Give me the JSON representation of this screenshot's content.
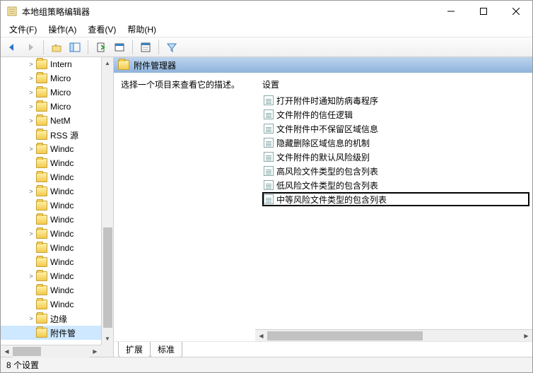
{
  "window": {
    "title": "本地组策略编辑器"
  },
  "menubar": {
    "file": "文件(F)",
    "action": "操作(A)",
    "view": "查看(V)",
    "help": "帮助(H)"
  },
  "tree": {
    "items": [
      {
        "label": "Intern",
        "expander": ">"
      },
      {
        "label": "Micro",
        "expander": ">"
      },
      {
        "label": "Micro",
        "expander": ">"
      },
      {
        "label": "Micro",
        "expander": ">"
      },
      {
        "label": "NetM",
        "expander": ">"
      },
      {
        "label": "RSS 源",
        "expander": ""
      },
      {
        "label": "Windc",
        "expander": ">"
      },
      {
        "label": "Windc",
        "expander": ""
      },
      {
        "label": "Windc",
        "expander": ""
      },
      {
        "label": "Windc",
        "expander": ">"
      },
      {
        "label": "Windc",
        "expander": ""
      },
      {
        "label": "Windc",
        "expander": ""
      },
      {
        "label": "Windc",
        "expander": ">"
      },
      {
        "label": "Windc",
        "expander": ""
      },
      {
        "label": "Windc",
        "expander": ""
      },
      {
        "label": "Windc",
        "expander": ">"
      },
      {
        "label": "Windc",
        "expander": ""
      },
      {
        "label": "Windc",
        "expander": ""
      },
      {
        "label": "边缘",
        "expander": ">"
      },
      {
        "label": "附件管",
        "expander": "",
        "selected": true
      }
    ]
  },
  "content": {
    "header": "附件管理器",
    "description_prompt": "选择一个项目来查看它的描述。",
    "settings_header": "设置",
    "settings": [
      "打开附件时通知防病毒程序",
      "文件附件的信任逻辑",
      "文件附件中不保留区域信息",
      "隐藏删除区域信息的机制",
      "文件附件的默认风险级别",
      "高风险文件类型的包含列表",
      "低风险文件类型的包含列表",
      "中等风险文件类型的包含列表"
    ],
    "highlighted_index": 7
  },
  "tabs": {
    "extended": "扩展",
    "standard": "标准"
  },
  "statusbar": {
    "text": "8 个设置"
  }
}
